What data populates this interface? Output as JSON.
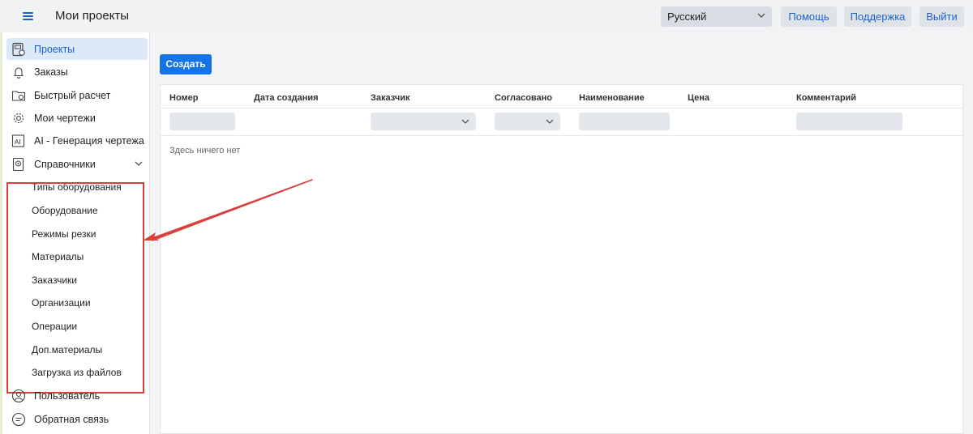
{
  "header": {
    "title": "Мои проекты",
    "language": "Русский",
    "buttons": {
      "help": "Помощь",
      "support": "Поддержка",
      "logout": "Выйти"
    }
  },
  "sidebar": {
    "items": [
      {
        "label": "Проекты",
        "icon": "projects-icon"
      },
      {
        "label": "Заказы",
        "icon": "bell-icon"
      },
      {
        "label": "Быстрый расчет",
        "icon": "folder-calc-icon"
      },
      {
        "label": "Мои чертежи",
        "icon": "gear-icon"
      },
      {
        "label": "AI - Генерация чертежа",
        "icon": "ai-icon"
      },
      {
        "label": "Справочники",
        "icon": "book-icon"
      }
    ],
    "submenu": [
      "Типы оборудования",
      "Оборудование",
      "Режимы резки",
      "Материалы",
      "Заказчики",
      "Организации",
      "Операции",
      "Доп.материалы"
    ],
    "upload_label": "Загрузка из файлов",
    "user_label": "Пользователь",
    "feedback_label": "Обратная связь"
  },
  "main": {
    "create_label": "Создать",
    "columns": [
      "Номер",
      "Дата создания",
      "Заказчик",
      "Согласовано",
      "Наименование",
      "Цена",
      "Комментарий"
    ],
    "empty_text": "Здесь ничего нет"
  },
  "colors": {
    "accent": "#1473e6",
    "link": "#1d63c8",
    "annotation": "#d8403c"
  }
}
